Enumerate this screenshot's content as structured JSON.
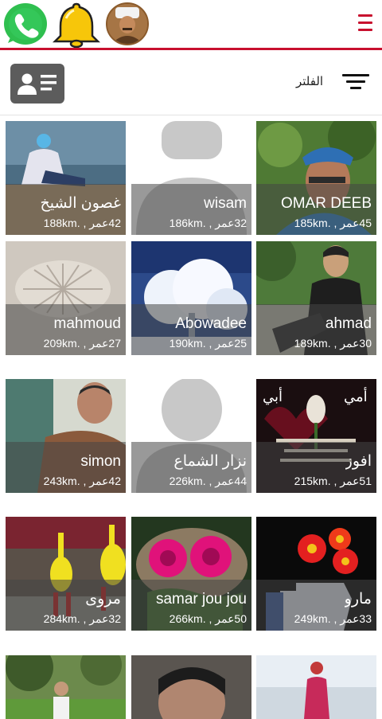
{
  "header": {
    "whatsapp_icon": "whatsapp-icon",
    "bell_icon": "bell-icon",
    "menu_icon": "hamburger-menu-icon",
    "accent_color": "#c8102e"
  },
  "filter": {
    "label": "الفلتر",
    "icon": "filter-lines-icon",
    "profile_button_icon": "contact-card-icon"
  },
  "profiles": [
    {
      "name": "OMAR DEEB",
      "age": "45عمر",
      "distance": ".185km"
    },
    {
      "name": "wisam",
      "age": "32عمر",
      "distance": ".186km"
    },
    {
      "name": "غصون الشيخ",
      "age": "42عمر",
      "distance": ".188km"
    },
    {
      "name": "ahmad",
      "age": "30عمر",
      "distance": ".189km"
    },
    {
      "name": "Abowadee",
      "age": "25عمر",
      "distance": ".190km"
    },
    {
      "name": "mahmoud",
      "age": "27عمر",
      "distance": ".209km"
    },
    {
      "name": "افوز",
      "age": "51عمر",
      "distance": ".215km"
    },
    {
      "name": "نزار الشماع",
      "age": "44عمر",
      "distance": ".226km"
    },
    {
      "name": "simon",
      "age": "42عمر",
      "distance": ".243km"
    },
    {
      "name": "مارو",
      "age": "33عمر",
      "distance": ".249km"
    },
    {
      "name": "samar jou jou",
      "age": "50عمر",
      "distance": ".266km"
    },
    {
      "name": "مروى",
      "age": "32عمر",
      "distance": ".284km"
    }
  ]
}
